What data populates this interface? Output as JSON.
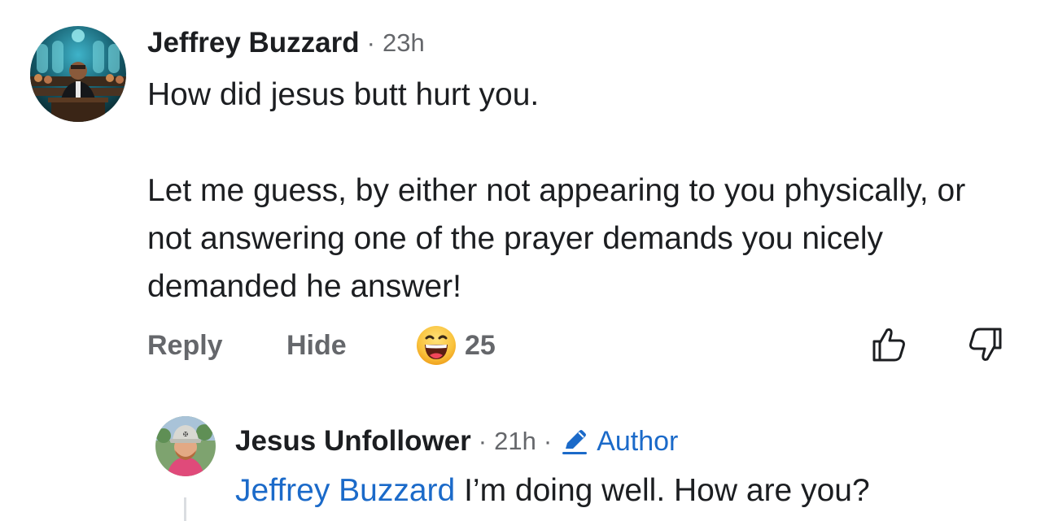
{
  "comment": {
    "author": "Jeffrey Buzzard",
    "separator": "·",
    "timestamp": "23h",
    "paragraphs": [
      "How did jesus butt hurt you.",
      "Let me guess, by either not appearing to you physically, or not answering one of the prayer demands you nicely demanded he answer!"
    ],
    "actions": {
      "reply": "Reply",
      "hide": "Hide"
    },
    "reaction": {
      "icon": "laughing-emoji-icon",
      "count": "25"
    }
  },
  "reply": {
    "author": "Jesus Unfollower",
    "separator": "·",
    "timestamp": "21h",
    "separator2": "·",
    "badge": "Author",
    "badge_icon": "pencil-icon",
    "mention": "Jeffrey Buzzard",
    "text": " I’m doing well. How are you?"
  },
  "colors": {
    "text": "#1c1e21",
    "secondary": "#65676b",
    "link": "#1b6ac9"
  }
}
